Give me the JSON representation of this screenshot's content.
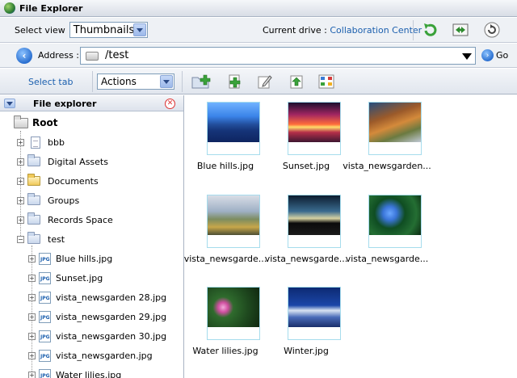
{
  "window": {
    "title": "File Explorer"
  },
  "toolbar": {
    "select_view_label": "Select view",
    "view_value": "Thumbnails",
    "current_drive_label": "Current drive :",
    "current_drive_value": "Collaboration Center",
    "icons": [
      "refresh-green-icon",
      "move-icon",
      "reload-circle-icon"
    ]
  },
  "address": {
    "label": "Address :",
    "value": "/test",
    "go_label": "Go"
  },
  "actions_bar": {
    "select_tab_label": "Select tab",
    "actions_value": "Actions",
    "icons": [
      "add-folder-icon",
      "add-document-icon",
      "edit-icon",
      "upload-icon",
      "sitemap-icon"
    ]
  },
  "tree": {
    "title": "File explorer",
    "root_label": "Root",
    "nodes": [
      {
        "label": "bbb",
        "icon": "document-icon"
      },
      {
        "label": "Digital Assets",
        "icon": "folder-icon"
      },
      {
        "label": "Documents",
        "icon": "folder-yellow-icon"
      },
      {
        "label": "Groups",
        "icon": "folder-icon"
      },
      {
        "label": "Records Space",
        "icon": "folder-icon"
      },
      {
        "label": "test",
        "icon": "folder-open-icon"
      }
    ],
    "children": [
      {
        "label": "Blue hills.jpg"
      },
      {
        "label": "Sunset.jpg"
      },
      {
        "label": "vista_newsgarden 28.jpg"
      },
      {
        "label": "vista_newsgarden 29.jpg"
      },
      {
        "label": "vista_newsgarden 30.jpg"
      },
      {
        "label": "vista_newsgarden.jpg"
      },
      {
        "label": "Water lilies.jpg"
      }
    ]
  },
  "files": [
    {
      "caption": "Blue hills.jpg"
    },
    {
      "caption": "Sunset.jpg"
    },
    {
      "caption": "vista_newsgarden..."
    },
    {
      "caption": "vista_newsgarde..."
    },
    {
      "caption": "vista_newsgarde..."
    },
    {
      "caption": "vista_newsgarde..."
    },
    {
      "caption": "Water lilies.jpg"
    },
    {
      "caption": "Winter.jpg"
    }
  ]
}
